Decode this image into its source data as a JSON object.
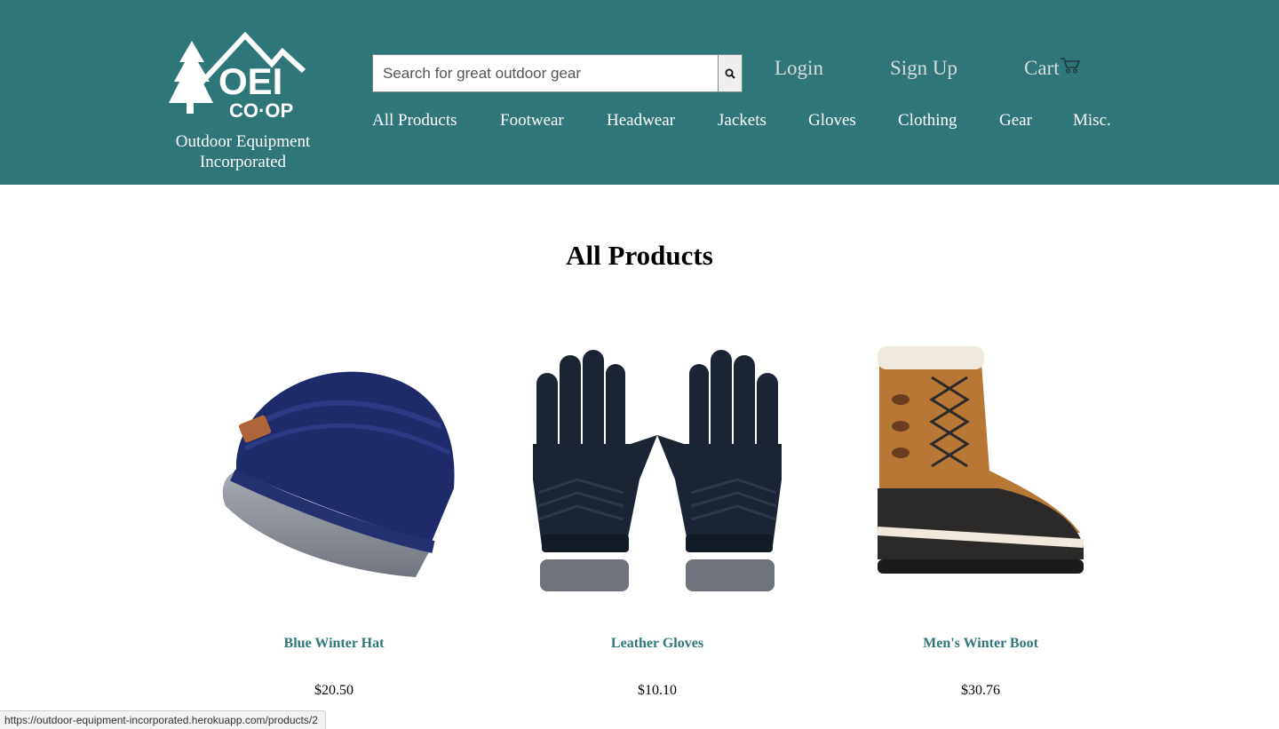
{
  "brand": {
    "logo_text_top": "OEI",
    "logo_text_bottom": "CO·OP",
    "tagline_line1": "Outdoor Equipment",
    "tagline_line2": "Incorporated"
  },
  "search": {
    "placeholder": "Search for great outdoor gear",
    "value": "",
    "button_icon": "search-icon"
  },
  "account": {
    "login": "Login",
    "signup": "Sign Up",
    "cart": "Cart",
    "cart_icon": "cart-icon"
  },
  "nav": {
    "items": [
      {
        "label": "All Products"
      },
      {
        "label": "Footwear"
      },
      {
        "label": "Headwear"
      },
      {
        "label": "Jackets"
      },
      {
        "label": "Gloves"
      },
      {
        "label": "Clothing"
      },
      {
        "label": "Gear"
      },
      {
        "label": "Misc."
      }
    ]
  },
  "main": {
    "title": "All Products",
    "products": [
      {
        "name": "Blue Winter Hat",
        "price": "$20.50"
      },
      {
        "name": "Leather Gloves",
        "price": "$10.10"
      },
      {
        "name": "Men's Winter Boot",
        "price": "$30.76"
      }
    ]
  },
  "status_url": "https://outdoor-equipment-incorporated.herokuapp.com/products/2",
  "colors": {
    "header_bg": "#2e7677",
    "accent": "#2e7677",
    "muted_link": "#d8dbdb"
  }
}
